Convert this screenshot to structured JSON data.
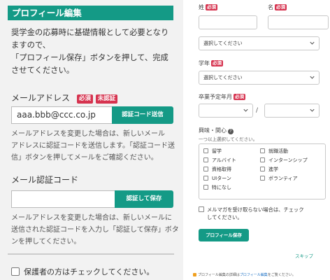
{
  "left": {
    "section_title": "プロフィール編集",
    "intro_lines": [
      "奨学金の応募時に基礎情報として必要となり",
      "ますので、",
      "「プロフィール保存」ボタンを押して、完成",
      "させてください。"
    ],
    "email": {
      "label": "メールアドレス",
      "required_badge": "必須",
      "unverified_badge": "未認証",
      "value": "aaa.bbb@ccc.co.jp",
      "send_button": "認証コード送信",
      "help_lines": [
        "メールアドレスを変更した場合は、新しいメール",
        "アドレスに認証コードを送信します。「認証コード送",
        "信」ボタンを押してメールをご確認ください。"
      ]
    },
    "code": {
      "label": "メール認証コード",
      "value": "",
      "verify_button": "認証して保存",
      "help_lines": [
        "メールアドレスを変更した場合は、新しいメールに",
        "送信された認証コードを入力し「認証して保存」ボタ",
        "ンを押してください。"
      ]
    },
    "guardian_check": "保護者の方はチェックしてください。"
  },
  "right": {
    "last_name_label": "姓",
    "first_name_label": "名",
    "required_badge": "必須",
    "select_placeholder": "選択してください",
    "grade_label": "学年",
    "graduation_label": "卒業予定年月",
    "date_separator": "/",
    "interests_label": "興味・関心",
    "interests_hint": "一つ以上選択してください。",
    "interests_options": [
      "留学",
      "就職活動",
      "アルバイト",
      "インターンシップ",
      "資格取得",
      "進学",
      "UIターン",
      "ボランティア",
      "特になし"
    ],
    "newsletter_lines": [
      "メルマガを受け取らない場合は、チェック",
      "してください。"
    ],
    "save_button": "プロフィール保存",
    "skip_link": "スキップ",
    "footer": {
      "prefix": "プロフィール編集の詳細は",
      "link": "プロフィール編集",
      "suffix": "をご覧ください。"
    }
  },
  "colors": {
    "accent": "#149a86",
    "badge": "#d6334f",
    "panel_bg": "#f2f2f2"
  }
}
